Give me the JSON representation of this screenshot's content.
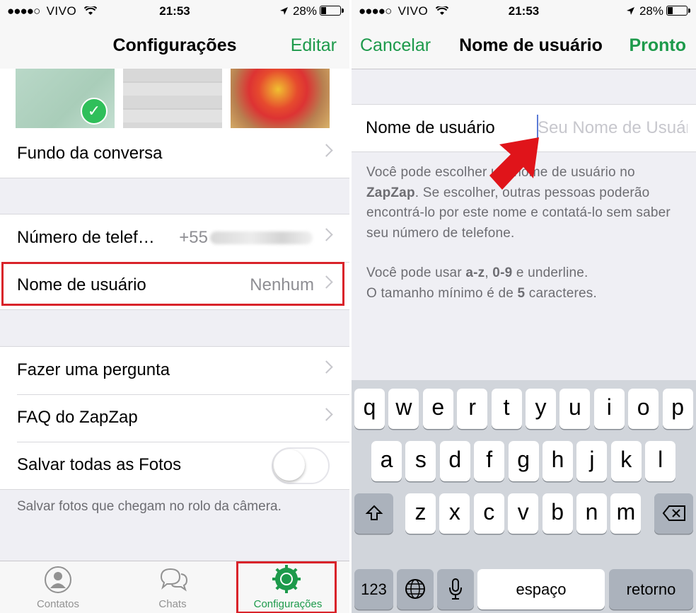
{
  "status_bar": {
    "carrier": "VIVO",
    "time": "21:53",
    "battery": "28%"
  },
  "left": {
    "nav": {
      "title": "Configurações",
      "edit": "Editar"
    },
    "rows": {
      "wallpaper": "Fundo da conversa",
      "phone_label": "Número de telef…",
      "phone_value": "+55",
      "username_label": "Nome de usuário",
      "username_value": "Nenhum",
      "ask": "Fazer uma pergunta",
      "faq": "FAQ do ZapZap",
      "save_photos": "Salvar todas as Fotos"
    },
    "save_photos_on": false,
    "footnote": "Salvar fotos que chegam no rolo da câmera.",
    "tabs": [
      "Contatos",
      "Chats",
      "Configurações"
    ]
  },
  "right": {
    "nav": {
      "cancel": "Cancelar",
      "title": "Nome de usuário",
      "done": "Pronto"
    },
    "field_label": "Nome de usuário",
    "field_placeholder": "Seu Nome de Usuário",
    "help": {
      "p1_a": "Você pode escolher um nome de usuário no ",
      "p1_b": "ZapZap",
      "p1_c": ". Se escolher, outras pessoas poderão encontrá-lo por este nome e contatá-lo sem saber seu número de telefone.",
      "p2_a": "Você pode usar ",
      "p2_b": "a-z",
      "p2_c": ", ",
      "p2_d": "0-9",
      "p2_e": " e underline.",
      "p3_a": "O tamanho mínimo é de ",
      "p3_b": "5",
      "p3_c": " caracteres."
    },
    "keyboard": {
      "row1": [
        "q",
        "w",
        "e",
        "r",
        "t",
        "y",
        "u",
        "i",
        "o",
        "p"
      ],
      "row2": [
        "a",
        "s",
        "d",
        "f",
        "g",
        "h",
        "j",
        "k",
        "l"
      ],
      "row3": [
        "z",
        "x",
        "c",
        "v",
        "b",
        "n",
        "m"
      ],
      "numbers": "123",
      "space": "espaço",
      "return": "retorno"
    }
  },
  "colors": {
    "accent": "#1d9a4b",
    "highlight": "#d9232a",
    "arrow": "#e0141a"
  }
}
